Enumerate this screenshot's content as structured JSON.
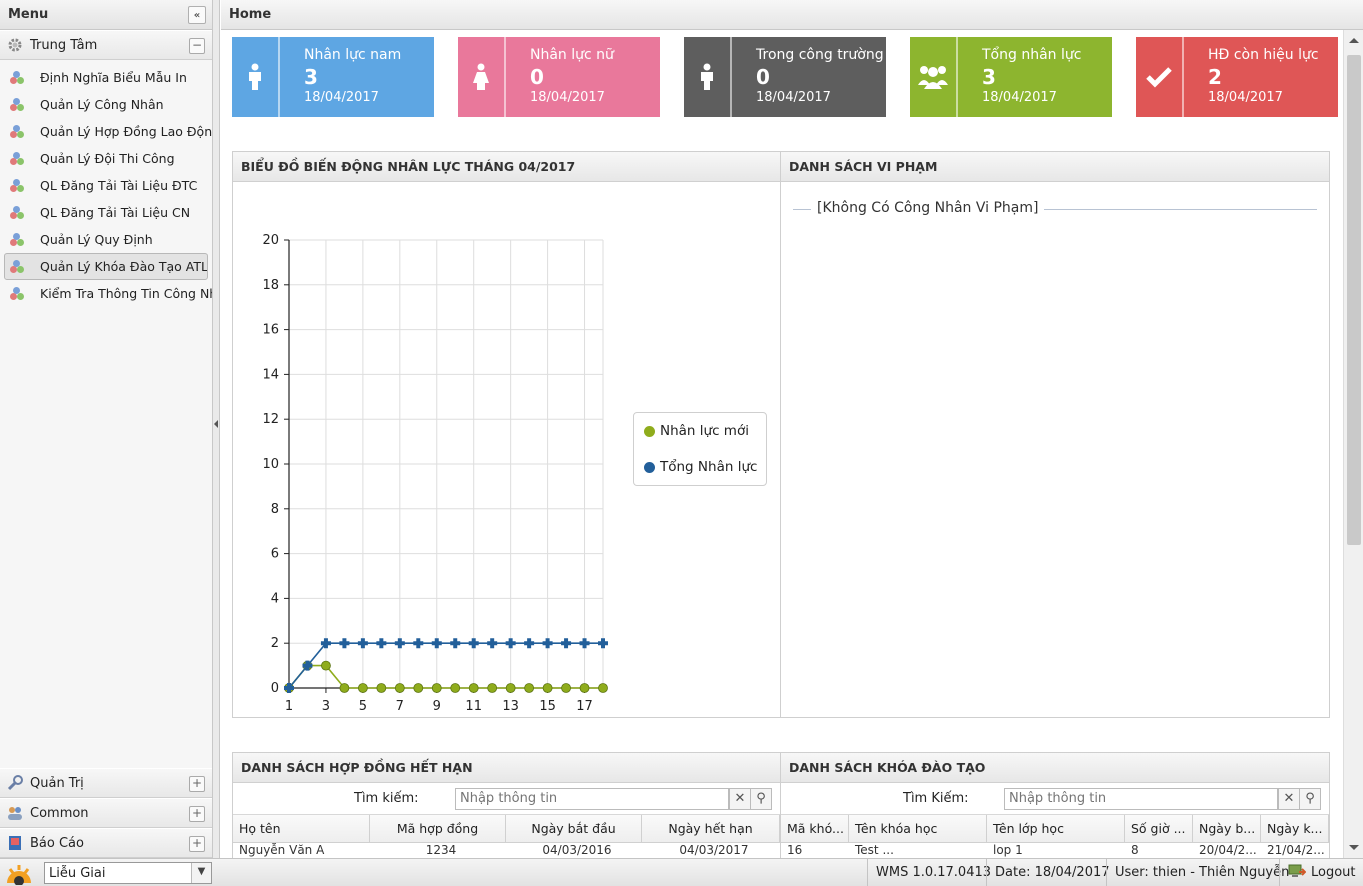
{
  "sidebar": {
    "title": "Menu",
    "group_trung_tam": "Trung Tâm",
    "items": [
      {
        "label": "Định Nghĩa Biểu Mẫu In"
      },
      {
        "label": "Quản Lý Công Nhân"
      },
      {
        "label": "Quản Lý Hợp Đồng Lao Động"
      },
      {
        "label": "Quản Lý Đội Thi Công"
      },
      {
        "label": "QL Đăng Tải Tài Liệu ĐTC"
      },
      {
        "label": "QL Đăng Tải Tài Liệu CN"
      },
      {
        "label": "Quản Lý Quy Định"
      },
      {
        "label": "Quản Lý Khóa Đào Tạo ATLĐ"
      },
      {
        "label": "Kiểm Tra Thông Tin Công Nhân"
      }
    ],
    "active_index": 7,
    "group_quan_tri": "Quản Trị",
    "group_common": "Common",
    "group_bao_cao": "Báo Cáo"
  },
  "main": {
    "title": "Home"
  },
  "tiles": [
    {
      "label": "Nhân lực nam",
      "value": "3",
      "date": "18/04/2017",
      "color": "#5ea6e3",
      "icon": "male-icon"
    },
    {
      "label": "Nhân lực nữ",
      "value": "0",
      "date": "18/04/2017",
      "color": "#e9789b",
      "icon": "female-icon"
    },
    {
      "label": "Trong công trường",
      "value": "0",
      "date": "18/04/2017",
      "color": "#5e5e5e",
      "icon": "worker-icon"
    },
    {
      "label": "Tổng nhân lực",
      "value": "3",
      "date": "18/04/2017",
      "color": "#8db52f",
      "icon": "group-icon"
    },
    {
      "label": "HĐ còn hiệu lực",
      "value": "2",
      "date": "18/04/2017",
      "color": "#df5656",
      "icon": "check-icon"
    }
  ],
  "chart_panel": {
    "title": "BIỂU ĐỒ BIẾN ĐỘNG NHÂN LỰC THÁNG 04/2017"
  },
  "violations": {
    "title": "DANH SÁCH VI PHẠM",
    "empty_text": "[Không Có Công Nhân Vi Phạm]"
  },
  "chart_data": {
    "type": "line",
    "x": [
      1,
      2,
      3,
      4,
      5,
      6,
      7,
      8,
      9,
      10,
      11,
      12,
      13,
      14,
      15,
      16,
      17,
      18
    ],
    "x_ticks": [
      1,
      3,
      5,
      7,
      9,
      11,
      13,
      15,
      17
    ],
    "ylim": [
      0,
      20
    ],
    "y_ticks": [
      0,
      2,
      4,
      6,
      8,
      10,
      12,
      14,
      16,
      18,
      20
    ],
    "grid": true,
    "legend_position": "right",
    "series": [
      {
        "name": "Nhân lực mới",
        "color": "#8fac1c",
        "marker": "circle",
        "values": [
          0,
          1,
          1,
          0,
          0,
          0,
          0,
          0,
          0,
          0,
          0,
          0,
          0,
          0,
          0,
          0,
          0,
          0
        ]
      },
      {
        "name": "Tổng Nhân lực",
        "color": "#225f9a",
        "marker": "cross",
        "values": [
          0,
          1,
          2,
          2,
          2,
          2,
          2,
          2,
          2,
          2,
          2,
          2,
          2,
          2,
          2,
          2,
          2,
          2
        ]
      }
    ]
  },
  "contracts": {
    "title": "DANH SÁCH HỢP ĐỒNG HẾT HẠN",
    "search_label": "Tìm kiếm:",
    "search_placeholder": "Nhập thông tin",
    "columns": [
      "Họ tên",
      "Mã hợp đồng",
      "Ngày bắt đầu",
      "Ngày hết hạn"
    ],
    "rows": [
      [
        "Nguyễn Văn A",
        "1234",
        "04/03/2016",
        "04/03/2017"
      ]
    ]
  },
  "courses": {
    "title": "DANH SÁCH KHÓA ĐÀO TẠO",
    "search_label": "Tìm Kiếm:",
    "search_placeholder": "Nhập thông tin",
    "columns": [
      "Mã khó...",
      "Tên khóa học",
      "Tên lớp học",
      "Số giờ ...",
      "Ngày b...",
      "Ngày k..."
    ],
    "rows": [
      [
        "16",
        "Test ...",
        "lop 1",
        "8",
        "20/04/2...",
        "21/04/2..."
      ]
    ]
  },
  "statusbar": {
    "project": "Liễu Giai",
    "version": "WMS 1.0.17.0413",
    "date": "Date: 18/04/2017",
    "user": "User: thien - Thiên Nguyễn",
    "logout": "Logout"
  },
  "colors": {
    "border": "#c8c8c8",
    "panel_header": "#e7e7e7"
  }
}
